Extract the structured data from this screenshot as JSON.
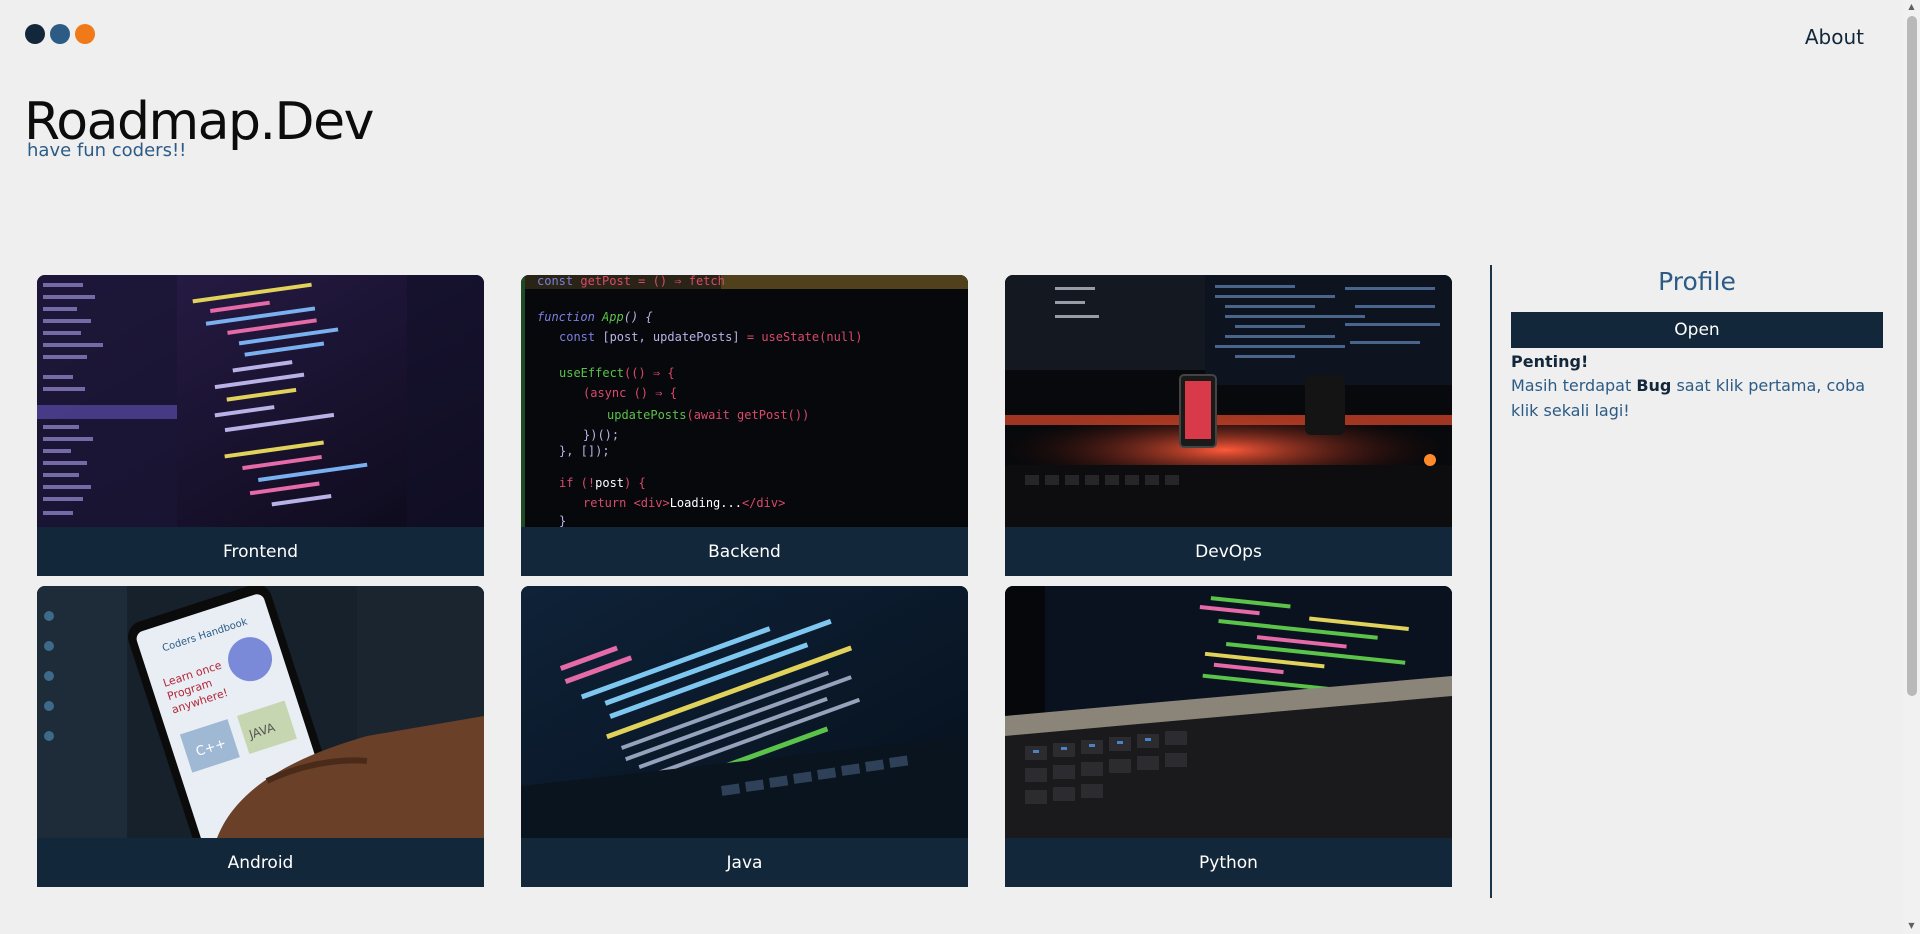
{
  "header": {
    "dots": [
      "#13273a",
      "#2c5b86",
      "#f07918"
    ],
    "about_label": "About"
  },
  "brand": {
    "title": "Roadmap.Dev",
    "subtitle": "have fun coders!!"
  },
  "cards": [
    {
      "label": "Frontend",
      "image": "code-editor-photo"
    },
    {
      "label": "Backend",
      "image": "code-editor-photo"
    },
    {
      "label": "DevOps",
      "image": "desk-setup-photo"
    },
    {
      "label": "Android",
      "image": "phone-app-photo"
    },
    {
      "label": "Java",
      "image": "laptop-code-photo"
    },
    {
      "label": "Python",
      "image": "laptop-keyboard-photo"
    }
  ],
  "profile": {
    "title": "Profile",
    "open_label": "Open",
    "note_title": "Penting!",
    "note_text_before": "Masih terdapat ",
    "note_bold": "Bug",
    "note_text_after": " saat klik pertama, coba klik sekali lagi!"
  }
}
